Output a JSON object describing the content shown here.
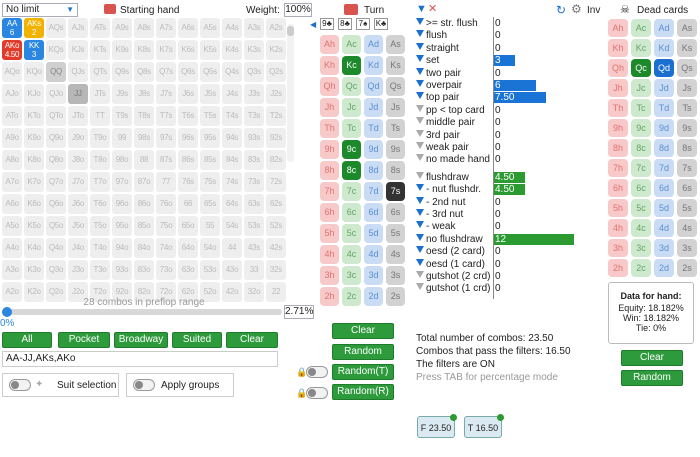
{
  "top": {
    "game_select": "No limit",
    "starting_hand_label": "Starting hand",
    "weight_label": "Weight:",
    "weight_value": "100%",
    "turn_label": "Turn",
    "inv_label": "Inv",
    "dead_cards_label": "Dead cards"
  },
  "grid": [
    [
      "AA|6",
      "AKs|2",
      "AQs",
      "AJs",
      "ATs",
      "A9s",
      "A8s",
      "A7s",
      "A6s",
      "A5s",
      "A4s",
      "A3s",
      "A2s"
    ],
    [
      "AKo|4.50",
      "KK|3",
      "KQs",
      "KJs",
      "KTs",
      "K9s",
      "K8s",
      "K7s",
      "K6s",
      "K5s",
      "K4s",
      "K3s",
      "K2s"
    ],
    [
      "AQo",
      "KQo",
      "QQ",
      "QJs",
      "QTs",
      "Q9s",
      "Q8s",
      "Q7s",
      "Q6s",
      "Q5s",
      "Q4s",
      "Q3s",
      "Q2s"
    ],
    [
      "AJo",
      "KJo",
      "QJo",
      "JJ",
      "JTs",
      "J9s",
      "J8s",
      "J7s",
      "J6s",
      "J5s",
      "J4s",
      "J3s",
      "J2s"
    ],
    [
      "ATo",
      "KTo",
      "QTo",
      "JTo",
      "TT",
      "T9s",
      "T8s",
      "T7s",
      "T6s",
      "T5s",
      "T4s",
      "T3s",
      "T2s"
    ],
    [
      "A9o",
      "K9o",
      "Q9o",
      "J9o",
      "T9o",
      "99",
      "98s",
      "97s",
      "96s",
      "95s",
      "94s",
      "93s",
      "92s"
    ],
    [
      "A8o",
      "K8o",
      "Q8o",
      "J8o",
      "T8o",
      "98o",
      "88",
      "87s",
      "86s",
      "85s",
      "84s",
      "83s",
      "82s"
    ],
    [
      "A7o",
      "K7o",
      "Q7o",
      "J7o",
      "T7o",
      "97o",
      "87o",
      "77",
      "76s",
      "75s",
      "74s",
      "73s",
      "72s"
    ],
    [
      "A6o",
      "K6o",
      "Q6o",
      "J6o",
      "T6o",
      "96o",
      "86o",
      "76o",
      "66",
      "65s",
      "64s",
      "63s",
      "62s"
    ],
    [
      "A5o",
      "K5o",
      "Q5o",
      "J5o",
      "T5o",
      "95o",
      "85o",
      "75o",
      "65o",
      "55",
      "54s",
      "53s",
      "52s"
    ],
    [
      "A4o",
      "K4o",
      "Q4o",
      "J4o",
      "T4o",
      "94o",
      "84o",
      "74o",
      "64o",
      "54o",
      "44",
      "43s",
      "42s"
    ],
    [
      "A3o",
      "K3o",
      "Q3o",
      "J3o",
      "T3o",
      "93o",
      "83o",
      "73o",
      "63o",
      "53o",
      "43o",
      "33",
      "32s"
    ],
    [
      "A2o",
      "K2o",
      "Q2o",
      "J2o",
      "T2o",
      "92o",
      "82o",
      "72o",
      "62o",
      "52o",
      "42o",
      "32o",
      "22"
    ]
  ],
  "grid_styles": {
    "AA|6": "blue",
    "AKs|2": "orange",
    "AKo|4.50": "red",
    "KK|3": "blue",
    "QQ": "grey",
    "JJ": "dark"
  },
  "range": {
    "combos_text": "28 combos in preflop range",
    "pct_label": "0%",
    "pct_value": "2.71%",
    "range_text": "AA-JJ,AKs,AKo",
    "suit_selection": "Suit selection",
    "apply_groups": "Apply groups"
  },
  "buttons": {
    "all": "All",
    "pocket": "Pocket",
    "broadway": "Broadway",
    "suited": "Suited",
    "clear": "Clear"
  },
  "board": {
    "cards": [
      "9♣",
      "8♣",
      "7♠",
      "K♣"
    ],
    "clear": "Clear",
    "random": "Random",
    "random_t": "Random(T)",
    "random_r": "Random(R)"
  },
  "filters": [
    {
      "label": ">= str. flush",
      "value": "0",
      "checked": true
    },
    {
      "label": "flush",
      "value": "0",
      "checked": true
    },
    {
      "label": "straight",
      "value": "0",
      "checked": true
    },
    {
      "label": "set",
      "value": "3",
      "checked": true,
      "bar": 0.25,
      "color": "blue"
    },
    {
      "label": "two pair",
      "value": "0",
      "checked": true
    },
    {
      "label": "overpair",
      "value": "6",
      "checked": true,
      "bar": 0.5,
      "color": "blue"
    },
    {
      "label": "top pair",
      "value": "7.50",
      "checked": true,
      "bar": 0.62,
      "color": "blue"
    },
    {
      "label": "pp < top card",
      "value": "0",
      "checked": false
    },
    {
      "label": "middle pair",
      "value": "0",
      "checked": false
    },
    {
      "label": "3rd pair",
      "value": "0",
      "checked": false
    },
    {
      "label": "weak pair",
      "value": "0",
      "checked": false
    },
    {
      "label": "no made hand",
      "value": "0",
      "checked": false
    },
    {
      "label": "flushdraw",
      "value": "4.50",
      "checked": false,
      "bar": 0.37,
      "color": "green"
    },
    {
      "label": "- nut flushdr.",
      "value": "4.50",
      "checked": true,
      "bar": 0.37,
      "color": "green"
    },
    {
      "label": "- 2nd nut",
      "value": "0",
      "checked": true
    },
    {
      "label": "- 3rd nut",
      "value": "0",
      "checked": true
    },
    {
      "label": "- weak",
      "value": "0",
      "checked": true
    },
    {
      "label": "no flushdraw",
      "value": "12",
      "checked": true,
      "bar": 0.95,
      "color": "green"
    },
    {
      "label": "oesd (2 card)",
      "value": "0",
      "checked": true
    },
    {
      "label": "oesd (1 card)",
      "value": "0",
      "checked": true
    },
    {
      "label": "gutshot (2 crd)",
      "value": "0",
      "checked": false
    },
    {
      "label": "gutshot (1 crd)",
      "value": "0",
      "checked": false
    }
  ],
  "summary": {
    "total": "Total number of combos: 23.50",
    "pass": "Combos that pass the filters: 16.50",
    "filters_on": "The filters are ON",
    "hint": "Press TAB for percentage mode"
  },
  "badges": [
    {
      "letter": "F",
      "value": "23.50"
    },
    {
      "letter": "T",
      "value": "16.50"
    }
  ],
  "hand_data": {
    "title": "Data for hand:",
    "equity": "Equity: 18.182%",
    "win": "Win: 18.182%",
    "tie": "Tie: 0%"
  },
  "dead": {
    "clear": "Clear",
    "random": "Random"
  }
}
